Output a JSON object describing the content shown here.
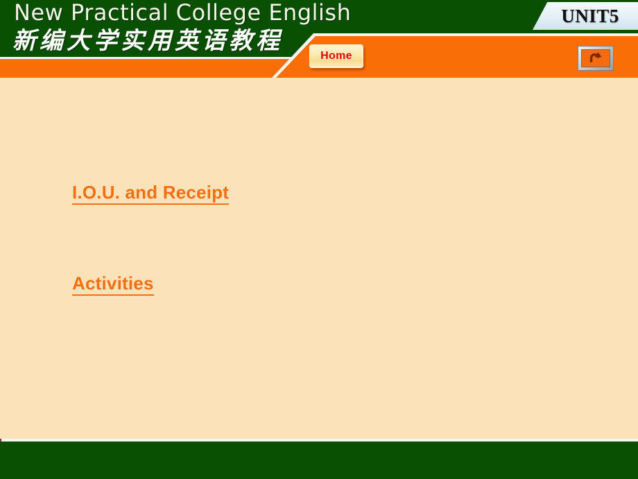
{
  "colors": {
    "green": "#0a5003",
    "orange": "#fa6e07",
    "cream": "#fbe2b8",
    "link_orange": "#f26f12",
    "home_red": "#e00000",
    "badge_blue": "#e2f0f6"
  },
  "header": {
    "title_en": "New Practical College English",
    "title_zh": "新编大学实用英语教程",
    "unit_badge": "UNIT5",
    "home_label": "Home",
    "return_icon_name": "return-arrow-icon"
  },
  "main": {
    "links": [
      {
        "label": "I.O.U. and Receipt"
      },
      {
        "label": "Activities"
      }
    ]
  }
}
